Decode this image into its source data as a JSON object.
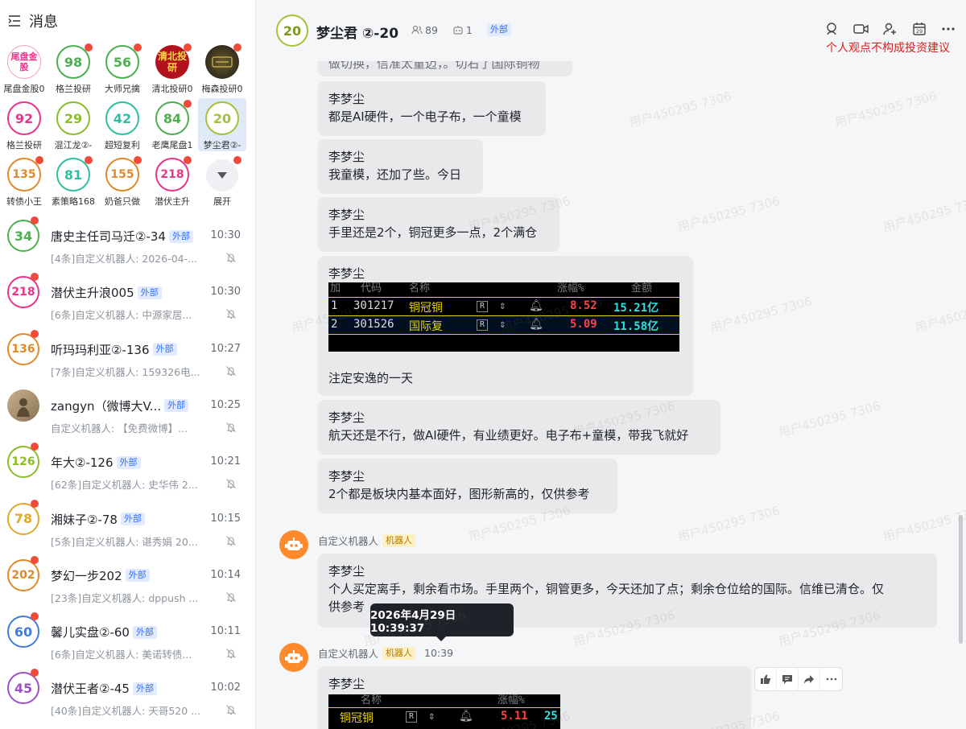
{
  "sidebar": {
    "title": "消息",
    "grid": [
      {
        "label": "尾盘金股0",
        "avatar_text": "尾盘金股",
        "type": "pic1",
        "dot": false
      },
      {
        "label": "格兰投研",
        "avatar_text": "98",
        "type": "circle",
        "color": "#4caf50",
        "dot": true
      },
      {
        "label": "大师兄擒",
        "avatar_text": "56",
        "type": "circle",
        "color": "#4caf50",
        "dot": true
      },
      {
        "label": "清北投研0",
        "avatar_text": "清北投研",
        "type": "pic2",
        "dot": true
      },
      {
        "label": "梅森投研0",
        "avatar_text": "",
        "type": "pic3",
        "dot": true
      },
      {
        "label": "格兰投研",
        "avatar_text": "92",
        "type": "circle",
        "color": "#e8358a",
        "dot": false
      },
      {
        "label": "混江龙②-",
        "avatar_text": "29",
        "type": "circle",
        "color": "#8bbd2b",
        "dot": false
      },
      {
        "label": "超短复利",
        "avatar_text": "42",
        "type": "circle",
        "color": "#2fbf9f",
        "dot": false
      },
      {
        "label": "老鹰尾盘1",
        "avatar_text": "84",
        "type": "circle",
        "color": "#4caf50",
        "dot": true
      },
      {
        "label": "梦尘君②-",
        "avatar_text": "20",
        "type": "circle",
        "color": "#a5c23a",
        "dot": false,
        "active": true
      },
      {
        "label": "转债小王",
        "avatar_text": "135",
        "type": "circle",
        "color": "#e0892a",
        "dot": true
      },
      {
        "label": "素策略168",
        "avatar_text": "81",
        "type": "circle",
        "color": "#2fbf9f",
        "dot": true
      },
      {
        "label": "奶爸只做",
        "avatar_text": "155",
        "type": "circle",
        "color": "#e0892a",
        "dot": true
      },
      {
        "label": "潜伏主升",
        "avatar_text": "218",
        "type": "circle",
        "color": "#e8358a",
        "dot": true
      },
      {
        "label": "展开",
        "avatar_text": "",
        "type": "expand",
        "dot": true
      }
    ],
    "chats": [
      {
        "name": "唐史主任司马迁②-34",
        "tag": "外部",
        "time": "10:30",
        "preview": "[4条]自定义机器人: 2026-04-...",
        "avatar": "34",
        "color": "#4caf50"
      },
      {
        "name": "潜伏主升浪005",
        "tag": "外部",
        "time": "10:30",
        "preview": "[6条]自定义机器人: 中源家居...",
        "avatar": "218",
        "color": "#e8358a"
      },
      {
        "name": "听玛玛利亚②-136",
        "tag": "外部",
        "time": "10:27",
        "preview": "[7条]自定义机器人: 159326电...",
        "avatar": "136",
        "color": "#e0892a"
      },
      {
        "name": "zangyn（微博大V...",
        "tag": "外部",
        "time": "10:25",
        "preview": "自定义机器人: 【免费微博】...",
        "avatar": "",
        "color": "#8a7356",
        "photo": true
      },
      {
        "name": "年大②-126",
        "tag": "外部",
        "time": "10:21",
        "preview": "[62条]自定义机器人: 史华伟 2...",
        "avatar": "126",
        "color": "#8bbd2b"
      },
      {
        "name": "湘妹子②-78",
        "tag": "外部",
        "time": "10:15",
        "preview": "[5条]自定义机器人: 谌秀娟 20...",
        "avatar": "78",
        "color": "#e0a92a"
      },
      {
        "name": "梦幻一步202",
        "tag": "外部",
        "time": "10:14",
        "preview": "[23条]自定义机器人: dppush ...",
        "avatar": "202",
        "color": "#e0892a"
      },
      {
        "name": "馨儿实盘②-60",
        "tag": "外部",
        "time": "10:11",
        "preview": "[6条]自定义机器人: 美诺转债...",
        "avatar": "60",
        "color": "#3f7be0"
      },
      {
        "name": "潜伏王者②-45",
        "tag": "外部",
        "time": "10:02",
        "preview": "[40条]自定义机器人: 天哥520 ...",
        "avatar": "45",
        "color": "#9b4fc9"
      }
    ]
  },
  "chat": {
    "avatar": "20",
    "title": "梦尘君 ②-20",
    "members": "89",
    "bots": "1",
    "tag": "外部",
    "disclaimer": "个人观点不构成投资建议",
    "top_partial": "做切换，信准太童迈，。切右了国际铜物",
    "messages": [
      {
        "sender": "李梦尘",
        "text": "都是AI硬件，一个电子布，一个童模"
      },
      {
        "sender": "李梦尘",
        "text": "我童模，还加了些。今日"
      },
      {
        "sender": "李梦尘",
        "text": "手里还是2个，铜冠更多一点，2个满仓"
      },
      {
        "sender": "李梦尘",
        "text": "注定安逸的一天"
      },
      {
        "sender": "李梦尘",
        "text": "航天还是不行，做AI硬件，有业绩更好。电子布+童模，带我飞就好"
      },
      {
        "sender": "李梦尘",
        "text": "2个都是板块内基本面好，图形新高的，仅供参考"
      }
    ],
    "stock_table": {
      "headers": [
        "加",
        "代码",
        "名称",
        "涨幅%",
        "金额"
      ],
      "rows": [
        {
          "idx": "1",
          "code": "301217",
          "name": "铜冠铜",
          "pct": "8.52",
          "amt": "15.21亿"
        },
        {
          "idx": "2",
          "code": "301526",
          "name": "国际复",
          "pct": "5.09",
          "amt": "11.58亿"
        }
      ]
    },
    "bot1": {
      "name": "自定义机器人",
      "tag": "机器人",
      "sender": "李梦尘",
      "text1": "个人买定离手，剩余看市场。手里两个，铜管更多，今天还加了点；剩余仓位给的国际。信维已清仓。仅",
      "text2": "供参考"
    },
    "tooltip": "2026年4月29日 10:39:37",
    "bot2": {
      "name": "自定义机器人",
      "tag": "机器人",
      "time": "10:39",
      "sender": "李梦尘",
      "stock": {
        "name": "铜冠铜",
        "pct": "5.11",
        "amt": "25",
        "hdr1": "名称",
        "hdr2": "涨幅%"
      }
    },
    "watermark": "用户450295 7306"
  }
}
